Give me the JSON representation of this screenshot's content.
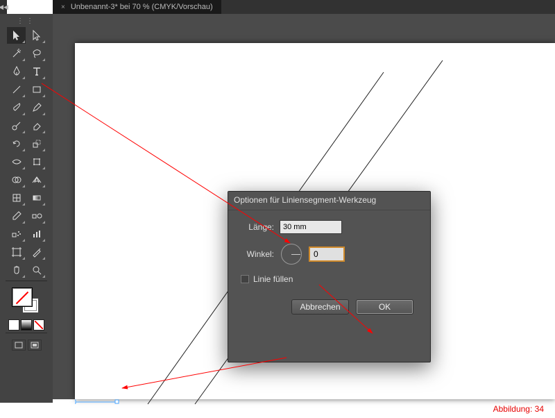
{
  "tab": {
    "title": "Unbenannt-3* bei 70 % (CMYK/Vorschau)",
    "close": "×"
  },
  "collapse": "◀◀",
  "dialog": {
    "title": "Optionen für Liniensegment-Werkzeug",
    "length_label": "Länge:",
    "length_value": "30 mm",
    "angle_label": "Winkel:",
    "angle_value": "0",
    "fill_label": "Linie füllen",
    "cancel": "Abbrechen",
    "ok": "OK"
  },
  "caption": "Abbildung: 34",
  "tools": {
    "selection": "Auswahl",
    "direct_selection": "Direktauswahl",
    "magic_wand": "Zauberstab",
    "lasso": "Lasso",
    "pen": "Zeichenstift",
    "type": "Text",
    "line_segment": "Liniensegment",
    "rectangle": "Rechteck",
    "paintbrush": "Pinsel",
    "pencil": "Buntstift",
    "blob_brush": "Tropfenpinsel",
    "eraser": "Radiergummi",
    "rotate": "Drehen",
    "scale": "Skalieren",
    "width": "Breite",
    "free_transform": "Frei-transformieren",
    "shape_builder": "Formerstellung",
    "perspective_grid": "Perspektivenraster",
    "mesh": "Gitter",
    "gradient": "Verlauf",
    "eyedropper": "Pipette",
    "blend": "Angleichen",
    "symbol_sprayer": "Symbol-aufsprühen",
    "column_graph": "Diagramm",
    "artboard": "Zeichenfläche",
    "slice": "Slice",
    "hand": "Hand",
    "zoom": "Zoom"
  }
}
